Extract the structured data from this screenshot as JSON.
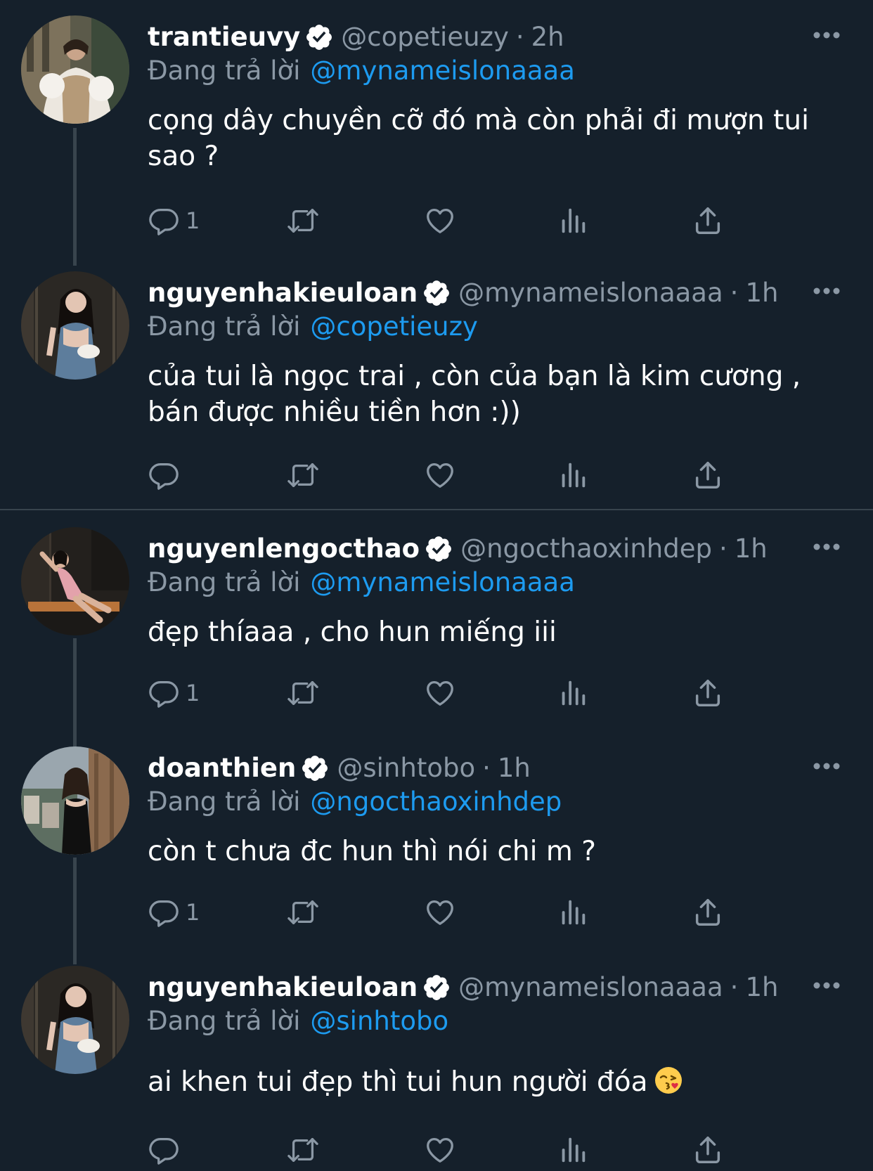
{
  "colors": {
    "background": "#15202b",
    "text": "#ffffff",
    "muted": "#8b98a5",
    "link": "#1d9bf0",
    "divider": "#38444d"
  },
  "tweets": [
    {
      "display_name": "trantieuvy",
      "handle": "@copetieuzy",
      "dot": "·",
      "time": "2h",
      "reply_prefix": "Đang trả lời",
      "reply_to": "@mynameislonaaaa",
      "text": "cọng dây chuyền cỡ đó mà còn phải đi mượn tui sao ?",
      "reply_count": "1",
      "icons": [
        "verified-icon",
        "more-icon",
        "reply-icon",
        "retweet-icon",
        "like-icon",
        "views-icon",
        "share-icon"
      ]
    },
    {
      "display_name": "nguyenhakieuloan",
      "handle": "@mynameislonaaaa",
      "dot": "·",
      "time": "1h",
      "reply_prefix": "Đang trả lời",
      "reply_to": "@copetieuzy",
      "text": "của tui là ngọc trai , còn của bạn là kim cương , bán được nhiều tiền hơn :))",
      "reply_count": "",
      "icons": [
        "verified-icon",
        "more-icon",
        "reply-icon",
        "retweet-icon",
        "like-icon",
        "views-icon",
        "share-icon"
      ]
    },
    {
      "display_name": "nguyenlengocthao",
      "handle": "@ngocthaoxinhdep",
      "dot": "·",
      "time": "1h",
      "reply_prefix": "Đang trả lời",
      "reply_to": "@mynameislonaaaa",
      "text": "đẹp thíaaa , cho hun miếng iii",
      "reply_count": "1",
      "icons": [
        "verified-icon",
        "more-icon",
        "reply-icon",
        "retweet-icon",
        "like-icon",
        "views-icon",
        "share-icon"
      ]
    },
    {
      "display_name": "doanthien",
      "handle": "@sinhtobo",
      "dot": "·",
      "time": "1h",
      "reply_prefix": "Đang trả lời",
      "reply_to": "@ngocthaoxinhdep",
      "text": "còn t chưa đc hun thì nói chi m ?",
      "reply_count": "1",
      "icons": [
        "verified-icon",
        "more-icon",
        "reply-icon",
        "retweet-icon",
        "like-icon",
        "views-icon",
        "share-icon"
      ]
    },
    {
      "display_name": "nguyenhakieuloan",
      "handle": "@mynameislonaaaa",
      "dot": "·",
      "time": "1h",
      "reply_prefix": "Đang trả lời",
      "reply_to": "@sinhtobo",
      "text": "ai khen tui đẹp thì tui hun người đóa",
      "emoji": "kissing-face-emoji",
      "reply_count": "",
      "icons": [
        "verified-icon",
        "more-icon",
        "reply-icon",
        "retweet-icon",
        "like-icon",
        "views-icon",
        "share-icon"
      ]
    }
  ]
}
